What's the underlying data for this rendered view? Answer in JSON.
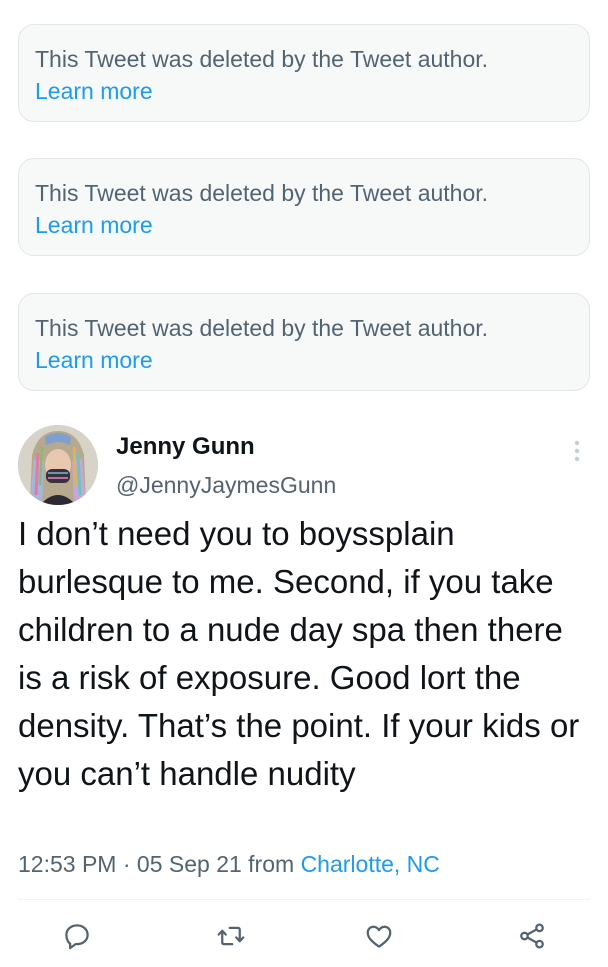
{
  "deleted_notices": [
    {
      "text": "This Tweet was deleted by the Tweet author.",
      "link": "Learn more"
    },
    {
      "text": "This Tweet was deleted by the Tweet author.",
      "link": "Learn more"
    },
    {
      "text": "This Tweet was deleted by the Tweet author.",
      "link": "Learn more"
    }
  ],
  "tweet": {
    "author_name": "Jenny Gunn",
    "author_handle": "@JennyJaymesGunn",
    "body": "I don’t need you to boyssplain burlesque to me. Second, if you take children to a nude day spa then there is a risk of exposure. Good lort the density. That’s the point. If your kids or you can’t handle nudity",
    "time": "12:53 PM",
    "separator": "·",
    "date": "05 Sep 21",
    "from_label": "from",
    "location": "Charlotte, NC"
  },
  "actions": [
    {
      "name": "reply",
      "icon": "reply-icon"
    },
    {
      "name": "retweet",
      "icon": "retweet-icon"
    },
    {
      "name": "like",
      "icon": "heart-icon"
    },
    {
      "name": "share",
      "icon": "share-icon"
    }
  ],
  "colors": {
    "accent": "#1d9bf0",
    "secondary_text": "#536471",
    "card_background": "#f7f9f9",
    "card_border": "#e2e6ea"
  }
}
